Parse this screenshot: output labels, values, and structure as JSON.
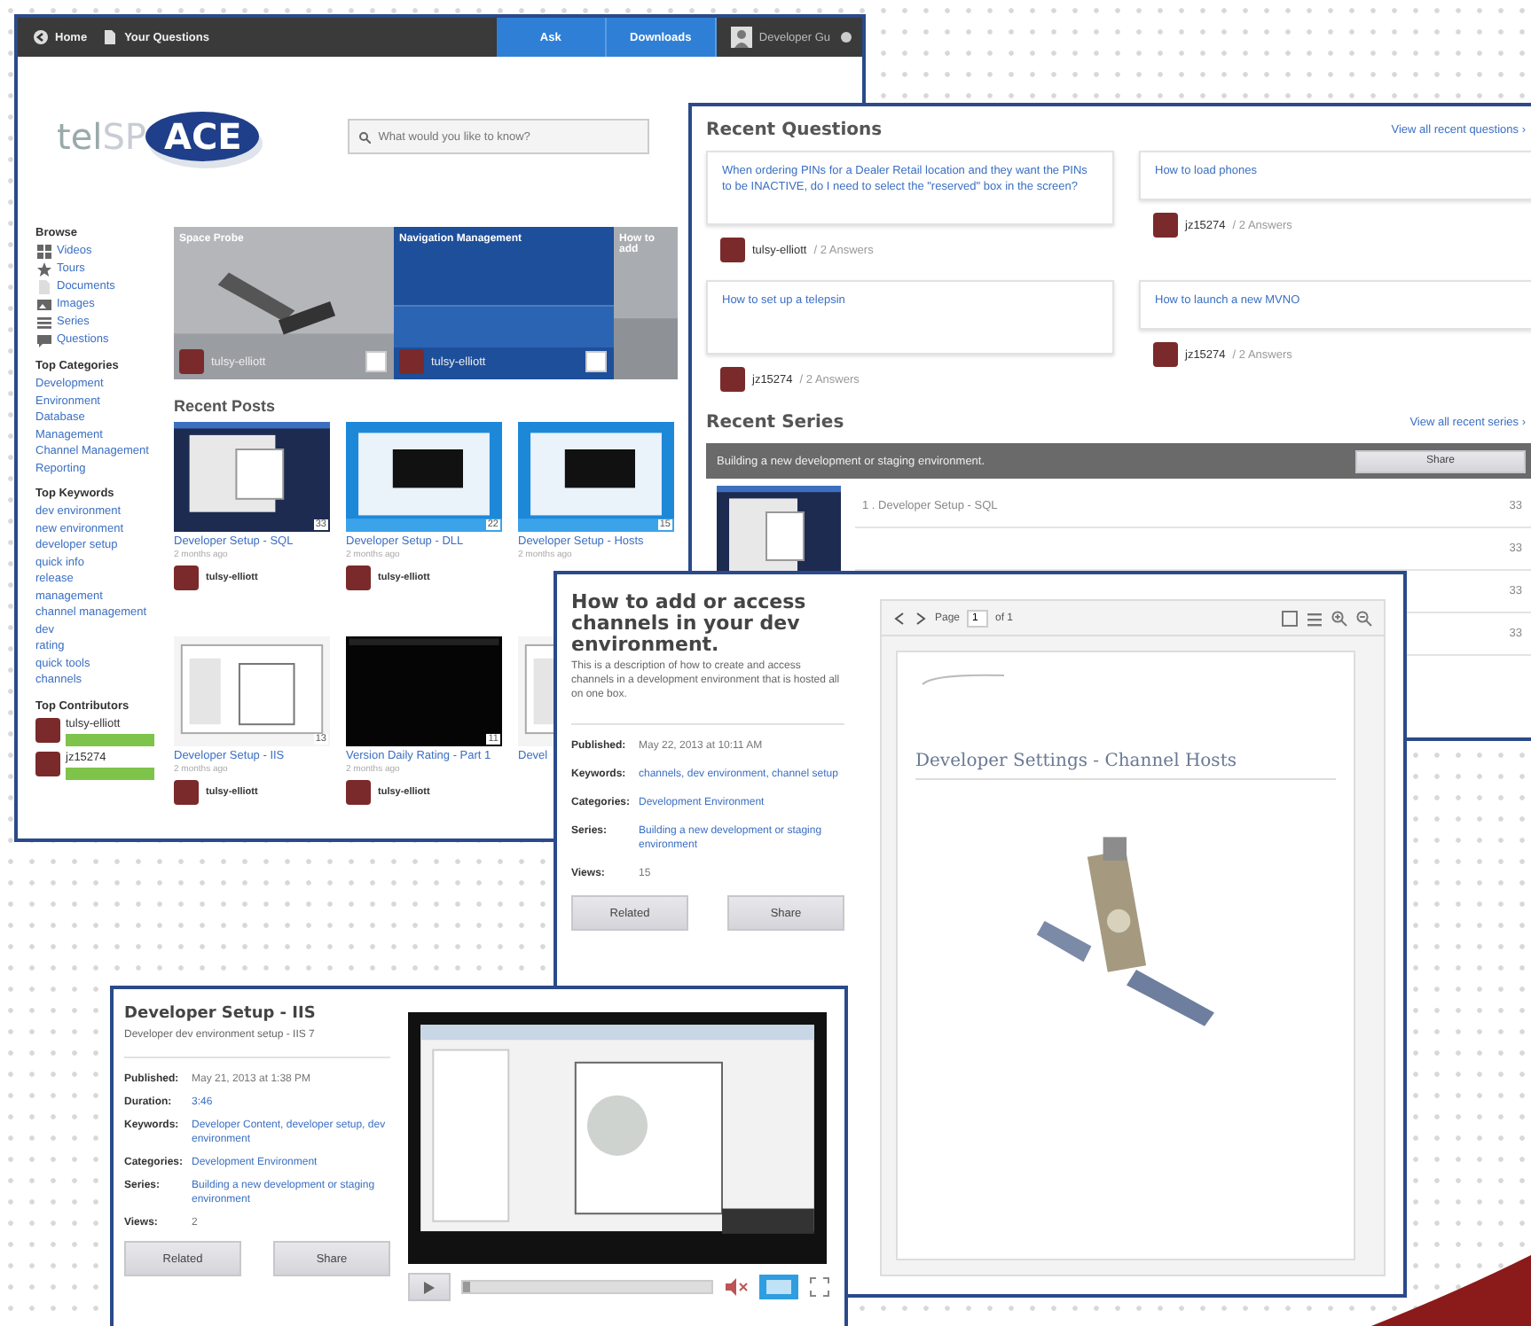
{
  "home": {
    "nav": [
      {
        "label": "Home"
      },
      {
        "label": "Your Questions"
      }
    ],
    "actions": [
      "Ask",
      "Downloads"
    ],
    "user": "Developer Gu",
    "logo": {
      "part_1": "tel",
      "part_2": "SP",
      "part_3": "ACE"
    },
    "search": {
      "placeholder": "What would you like to know?"
    },
    "sidebar": [
      {
        "heading": "Browse",
        "items": [
          {
            "label": "Videos"
          },
          {
            "label": "Tours"
          },
          {
            "label": "Documents"
          },
          {
            "label": "Images"
          },
          {
            "label": "Series"
          },
          {
            "label": "Questions"
          }
        ]
      },
      {
        "heading": "Top Categories",
        "items": [
          {
            "label": "Development"
          },
          {
            "label": "Environment"
          },
          {
            "label": "Database"
          },
          {
            "label": "Management"
          },
          {
            "label": "Channel Management"
          },
          {
            "label": "Reporting"
          }
        ]
      },
      {
        "heading": "Top Keywords",
        "items": [
          {
            "label": "dev environment"
          },
          {
            "label": "new environment"
          },
          {
            "label": "developer setup"
          },
          {
            "label": "quick info"
          },
          {
            "label": "release"
          },
          {
            "label": "management"
          },
          {
            "label": "channel management"
          },
          {
            "label": "dev"
          },
          {
            "label": "rating"
          },
          {
            "label": "quick tools"
          },
          {
            "label": "channels"
          }
        ]
      }
    ],
    "contributors_heading": "Top Contributors",
    "contributors": [
      {
        "name": "tulsy-elliott"
      },
      {
        "name": "jz15274"
      }
    ],
    "slides": [
      {
        "title": "Space Probe",
        "author": "tulsy-elliott",
        "selected": false
      },
      {
        "title": "Navigation Management",
        "author": "tulsy-elliott",
        "selected": true
      },
      {
        "title": "How to add",
        "selected": false
      }
    ],
    "recent_posts_heading": "Recent Posts",
    "posts": [
      {
        "title": "Developer Setup - SQL",
        "age": "2 months ago",
        "count": "33",
        "author": "tulsy-elliott"
      },
      {
        "title": "Developer Setup - DLL",
        "age": "2 months ago",
        "count": "22",
        "author": "tulsy-elliott"
      },
      {
        "title": "Developer Setup - Hosts",
        "age": "2 months ago",
        "count": "15"
      },
      {
        "title": "Developer Setup - IIS",
        "age": "2 months ago",
        "count": "13",
        "author": "tulsy-elliott"
      },
      {
        "title": "Version Daily Rating - Part 1",
        "age": "2 months ago",
        "count": "11",
        "author": "tulsy-elliott"
      },
      {
        "title": "Devel"
      }
    ]
  },
  "questions": {
    "heading": "Recent Questions",
    "view_all": "View all recent questions ›",
    "items": [
      {
        "text": "When ordering PINs for a Dealer Retail location and they want the PINs to be INACTIVE, do I need to select the \"reserved\" box in the screen?",
        "author": "tulsy-elliott",
        "answers": "/ 2 Answers"
      },
      {
        "text": "How to load phones",
        "author": "jz15274",
        "answers": "/ 2 Answers"
      },
      {
        "text": "How to set up a telepsin",
        "author": "jz15274",
        "answers": "/ 2 Answers"
      },
      {
        "text": "How to launch a new MVNO",
        "author": "jz15274",
        "answers": "/ 2 Answers"
      }
    ],
    "series_heading": "Recent Series",
    "series_view_all": "View all recent series ›",
    "series_title": "Building a new development or staging environment.",
    "share": "Share",
    "series_items": [
      {
        "label": "1 . Developer Setup - SQL",
        "count": "33"
      },
      {
        "count": "33"
      },
      {
        "count": "33"
      },
      {
        "count": "33"
      }
    ]
  },
  "document": {
    "title": "How to add or access channels in your dev environment.",
    "description": "This is a description of how to create and access channels in a development environment that is hosted all on one box.",
    "meta": [
      {
        "label": "Published:",
        "value": "May 22, 2013 at 10:11 AM",
        "link": false
      },
      {
        "label": "Keywords:",
        "value": "channels, dev environment, channel setup",
        "link": true
      },
      {
        "label": "Categories:",
        "value": "Development Environment",
        "link": true
      },
      {
        "label": "Series:",
        "value": "Building a new development or staging environment",
        "link": true
      },
      {
        "label": "Views:",
        "value": "15",
        "link": false
      }
    ],
    "buttons": [
      "Related",
      "Share"
    ],
    "viewer": {
      "page_label": "Page",
      "page": "1",
      "of": "of 1",
      "heading": "Developer Settings - Channel Hosts"
    }
  },
  "video": {
    "title": "Developer Setup - IIS",
    "subtitle": "Developer dev environment setup - IIS 7",
    "meta": [
      {
        "label": "Published:",
        "value": "May 21, 2013 at 1:38 PM",
        "link": false
      },
      {
        "label": "Duration:",
        "value": "3:46",
        "link": true
      },
      {
        "label": "Keywords:",
        "value": "Developer Content, developer setup, dev environment",
        "link": true
      },
      {
        "label": "Categories:",
        "value": "Development Environment",
        "link": true
      },
      {
        "label": "Series:",
        "value": "Building a new development or staging environment",
        "link": true
      },
      {
        "label": "Views:",
        "value": "2",
        "link": false
      }
    ],
    "buttons": [
      "Related",
      "Share"
    ],
    "progress": {
      "level": 0.03
    }
  }
}
